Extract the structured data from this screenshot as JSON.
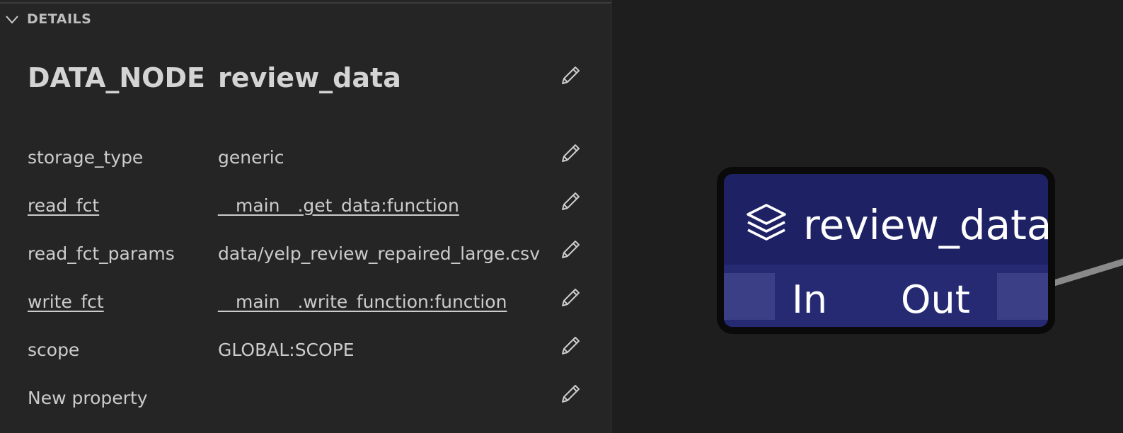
{
  "details": {
    "section_title": "DETAILS",
    "node_type": "DATA_NODE",
    "node_name": "review_data"
  },
  "properties": [
    {
      "key": "storage_type",
      "value": "generic",
      "link": false
    },
    {
      "key": "read_fct",
      "value": "__main__.get_data:function",
      "link": true
    },
    {
      "key": "read_fct_params",
      "value": "data/yelp_review_repaired_large.csv",
      "link": false
    },
    {
      "key": "write_fct",
      "value": "__main__.write_function:function",
      "link": true
    },
    {
      "key": "scope",
      "value": "GLOBAL:SCOPE",
      "link": false
    },
    {
      "key": "New property",
      "value": "",
      "link": false
    }
  ],
  "node": {
    "label": "review_data",
    "icon": "layers-icon",
    "port_in": "In",
    "port_out": "Out"
  },
  "colors": {
    "panel_bg": "#252526",
    "canvas_bg": "#1e1e1e",
    "node_header": "#1e2264",
    "node_ports": "#252a73",
    "edge": "#8a8a8a"
  }
}
